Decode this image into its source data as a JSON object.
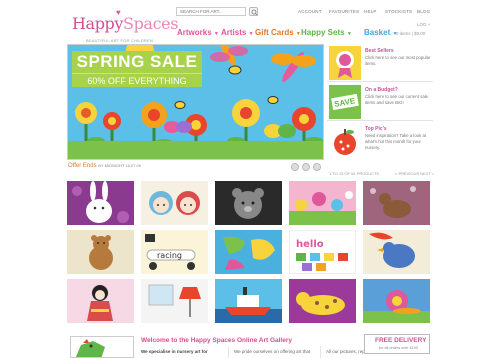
{
  "brand": {
    "name_part1": "Happy",
    "name_part2": "Spaces",
    "tagline": "BEAUTIFUL ART FOR CHILDREN"
  },
  "search": {
    "placeholder": "SEARCH FOR ART..."
  },
  "topnav": {
    "items": [
      "ACCOUNT",
      "FAVOURITES",
      "HELP",
      "STOCKISTS",
      "BLOG"
    ]
  },
  "account": {
    "login_label": "LOG + ",
    "basket_info": "0 items  |  $0.00"
  },
  "categories": [
    {
      "label": "Artworks",
      "color": "#e0579a"
    },
    {
      "label": "Artists",
      "color": "#e0579a"
    },
    {
      "label": "Gift Cards",
      "color": "#e07a2a"
    },
    {
      "label": "Happy Sets",
      "color": "#5fb548"
    },
    {
      "label": "Basket",
      "color": "#4aa6d8"
    }
  ],
  "hero": {
    "title": "SPRING SALE",
    "subtitle": "60% OFF EVERYTHING",
    "offer_label": "Offer Ends",
    "offer_detail": "BY MIDNIGHT 16.07.09"
  },
  "promos": [
    {
      "title": "Best Sellers",
      "desc": "Click here to see our most popular items.",
      "icon": "badge-icon"
    },
    {
      "title": "On a Budget?",
      "desc": "Click here to see our current sale items and save BIG!",
      "icon": "save-icon"
    },
    {
      "title": "Top Pic's",
      "desc": "Need inspiration? Take a look at what's hot this month for your nursery.",
      "icon": "apple-icon"
    }
  ],
  "pager": {
    "count": "1 TO 15 OF 64 PRODUCTS",
    "nav": "< PREVIOUS  NEXT >"
  },
  "products": [
    "bunny-art",
    "doll-girl-art",
    "teddy-photo-art",
    "flower-garden-art",
    "deer-art",
    "bear-art",
    "racing-art",
    "red-car-art",
    "map-art",
    "alphabet-art",
    "kimono-girl-art",
    "lamp-art",
    "boat-art",
    "leopard-art",
    "snail-art"
  ],
  "racing_word": "racing",
  "alphabet_word": "hello",
  "bottom": {
    "welcome": "Welcome to the Happy Spaces Online Art Gallery",
    "col1": "We specialise in nursery art for",
    "col2": "We pride ourselves on offering art that",
    "col3": "All our pictures, reproduced on cotton"
  },
  "free_delivery": {
    "title": "FREE DELIVERY",
    "sub": "for all orders over £100"
  },
  "colors": {
    "accent_pink": "#d24f94",
    "sky": "#5bbfe8",
    "grass": "#7cc24a"
  }
}
